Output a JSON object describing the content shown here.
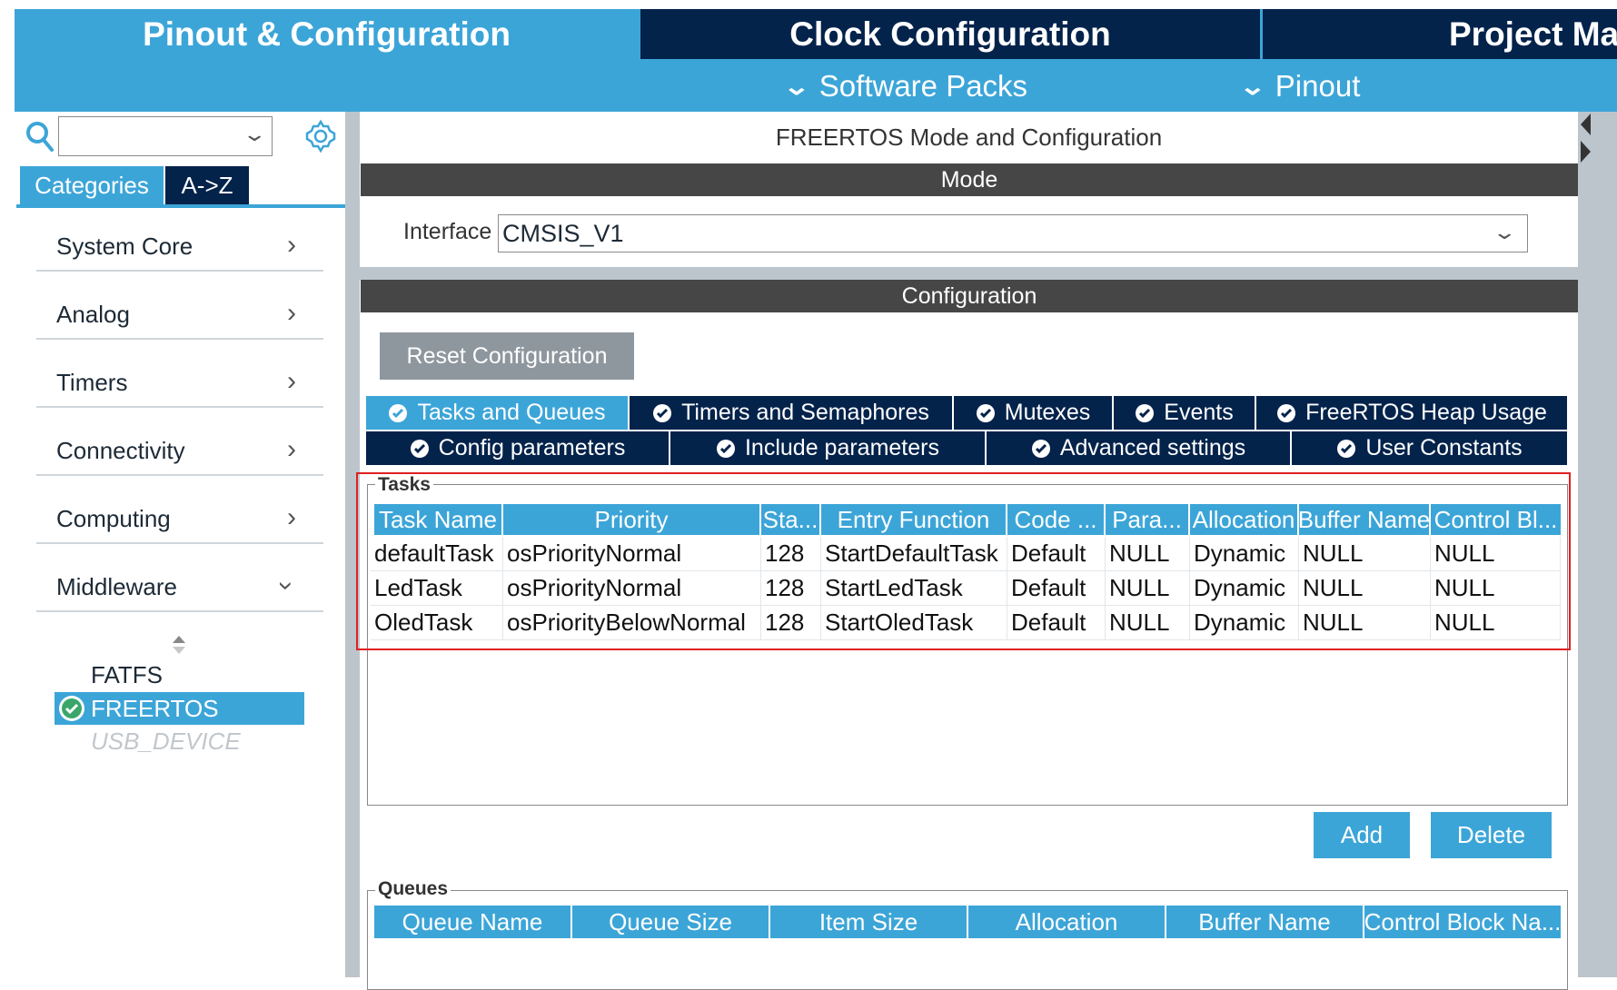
{
  "top_tabs": {
    "pinout": "Pinout & Configuration",
    "clock": "Clock Configuration",
    "project": "Project Mar"
  },
  "sub_tabs": {
    "software_packs": "Software Packs",
    "pinout": "Pinout"
  },
  "left": {
    "tabs": {
      "categories": "Categories",
      "az": "A->Z"
    },
    "categories": [
      {
        "label": "System Core"
      },
      {
        "label": "Analog"
      },
      {
        "label": "Timers"
      },
      {
        "label": "Connectivity"
      },
      {
        "label": "Computing"
      },
      {
        "label": "Middleware"
      }
    ],
    "middleware_items": {
      "fatfs": "FATFS",
      "freertos": "FREERTOS",
      "usb_device": "USB_DEVICE"
    }
  },
  "main": {
    "title": "FREERTOS Mode and Configuration",
    "mode_header": "Mode",
    "interface_label": "Interface",
    "interface_value": "CMSIS_V1",
    "config_header": "Configuration",
    "reset_button": "Reset Configuration",
    "config_tabs_row1": [
      "Tasks and Queues",
      "Timers and Semaphores",
      "Mutexes",
      "Events",
      "FreeRTOS Heap Usage"
    ],
    "config_tabs_row2": [
      "Config parameters",
      "Include parameters",
      "Advanced settings",
      "User Constants"
    ],
    "active_tab": "Tasks and Queues"
  },
  "tasks": {
    "group_label": "Tasks",
    "columns": [
      "Task Name",
      "Priority",
      "Sta...",
      "Entry Function",
      "Code ...",
      "Para...",
      "Allocation",
      "Buffer Name",
      "Control Bl..."
    ],
    "rows": [
      [
        "defaultTask",
        "osPriorityNormal",
        "128",
        "StartDefaultTask",
        "Default",
        "NULL",
        "Dynamic",
        "NULL",
        "NULL"
      ],
      [
        "LedTask",
        "osPriorityNormal",
        "128",
        "StartLedTask",
        "Default",
        "NULL",
        "Dynamic",
        "NULL",
        "NULL"
      ],
      [
        "OledTask",
        "osPriorityBelowNormal",
        "128",
        "StartOledTask",
        "Default",
        "NULL",
        "Dynamic",
        "NULL",
        "NULL"
      ]
    ],
    "add_button": "Add",
    "delete_button": "Delete"
  },
  "queues": {
    "group_label": "Queues",
    "columns": [
      "Queue Name",
      "Queue Size",
      "Item Size",
      "Allocation",
      "Buffer Name",
      "Control Block Na..."
    ]
  },
  "colors": {
    "accent": "#3ca5d8",
    "navy": "#03234b",
    "section_bar": "#464646",
    "highlight_border": "#e02020"
  }
}
